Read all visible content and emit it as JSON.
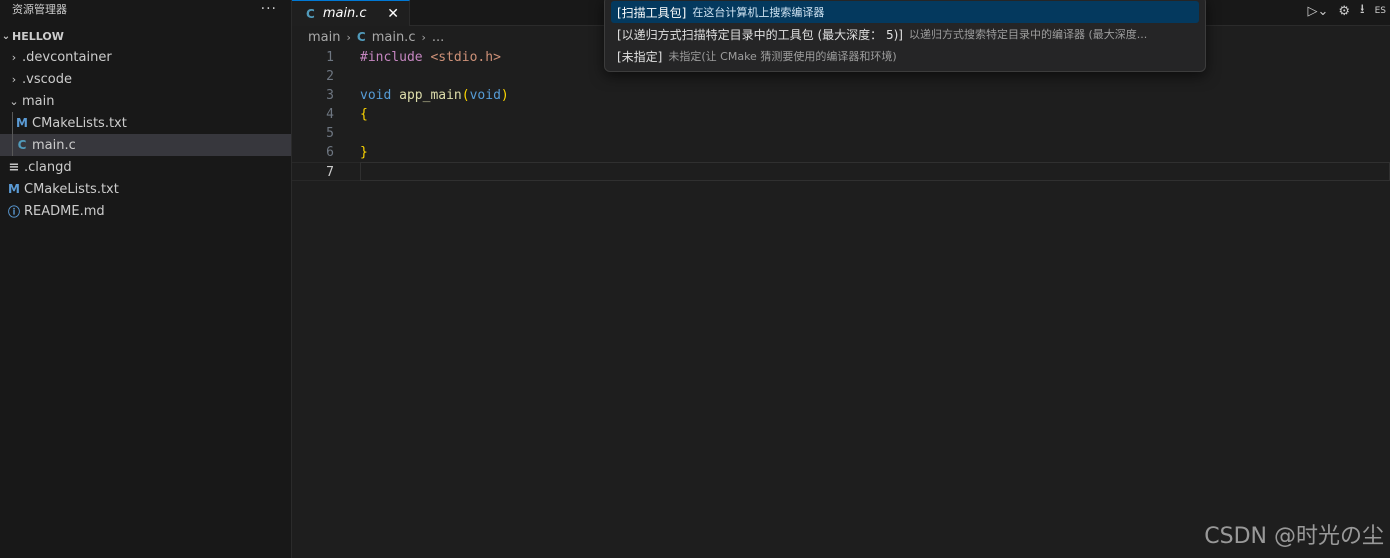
{
  "sidebar": {
    "title": "资源管理器",
    "more": "···",
    "section_title": "HELLOW",
    "items": [
      {
        "label": ".devcontainer",
        "icon": "chevron-right-icon",
        "type": "folder"
      },
      {
        "label": ".vscode",
        "icon": "chevron-right-icon",
        "type": "folder"
      },
      {
        "label": "main",
        "icon": "chevron-down-icon",
        "type": "folder-open"
      },
      {
        "label": "CMakeLists.txt",
        "icon": "cmake-file-icon",
        "glyph": "M",
        "type": "file"
      },
      {
        "label": "main.c",
        "icon": "c-file-icon",
        "glyph": "C",
        "type": "file",
        "selected": true
      },
      {
        "label": ".clangd",
        "icon": "lines-file-icon",
        "glyph": "≡",
        "type": "file"
      },
      {
        "label": "CMakeLists.txt",
        "icon": "cmake-file-icon",
        "glyph": "M",
        "type": "file"
      },
      {
        "label": "README.md",
        "icon": "info-file-icon",
        "glyph": "ⓘ",
        "type": "file"
      }
    ]
  },
  "tab": {
    "label": "main.c",
    "glyph": "C",
    "close": "✕"
  },
  "breadcrumb": {
    "folder": "main",
    "file": "main.c",
    "more": "..."
  },
  "title_actions": {
    "run": "▷⌄",
    "settings": "⚙",
    "download": "⭳",
    "extra": "ES"
  },
  "editor": {
    "lines": [
      {
        "number": "1",
        "tokens": [
          {
            "t": "#include ",
            "c": "pre"
          },
          {
            "t": "<stdio.h>",
            "c": "str"
          }
        ]
      },
      {
        "number": "2",
        "tokens": []
      },
      {
        "number": "3",
        "tokens": [
          {
            "t": "void ",
            "c": "kw"
          },
          {
            "t": "app_main",
            "c": "fn"
          },
          {
            "t": "(",
            "c": "br"
          },
          {
            "t": "void",
            "c": "kw"
          },
          {
            "t": ")",
            "c": "br"
          }
        ]
      },
      {
        "number": "4",
        "tokens": [
          {
            "t": "{",
            "c": "br"
          }
        ]
      },
      {
        "number": "5",
        "tokens": []
      },
      {
        "number": "6",
        "tokens": [
          {
            "t": "}",
            "c": "br"
          }
        ]
      },
      {
        "number": "7",
        "tokens": [],
        "current": true
      }
    ]
  },
  "quick_pick": {
    "items": [
      {
        "label": "[扫描工具包]",
        "description": "在这台计算机上搜索编译器",
        "active": true
      },
      {
        "label": "[以递归方式扫描特定目录中的工具包 (最大深度： 5)]",
        "description": "以递归方式搜索特定目录中的编译器 (最大深度..."
      },
      {
        "label": "[未指定]",
        "description": "未指定(让 CMake 猜测要使用的编译器和环境)"
      }
    ]
  },
  "watermark": "CSDN @时光の尘",
  "colors": {
    "accent": "#0078d4",
    "selection": "#04395e",
    "background": "#1e1e1e"
  }
}
